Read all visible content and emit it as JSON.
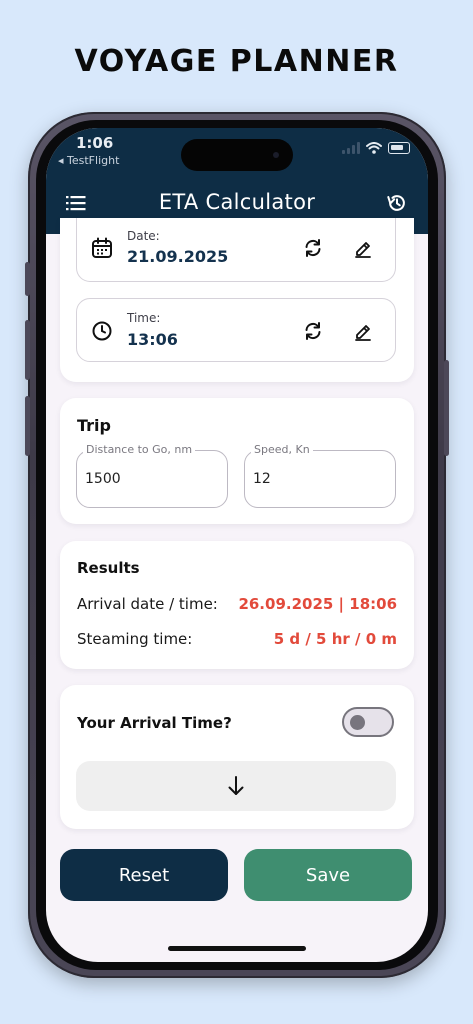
{
  "page": {
    "title": "VOYAGE PLANNER"
  },
  "status_bar": {
    "time": "1:06",
    "back_app": "◂ TestFlight"
  },
  "header": {
    "title": "ETA Calculator"
  },
  "datetime": {
    "date_label": "Date:",
    "date_value": "21.09.2025",
    "time_label": "Time:",
    "time_value": "13:06"
  },
  "trip": {
    "title": "Trip",
    "distance_label": "Distance to Go, nm",
    "distance_value": "1500",
    "speed_label": "Speed, Kn",
    "speed_value": "12"
  },
  "results": {
    "title": "Results",
    "arrival_label": "Arrival date / time:",
    "arrival_value": "26.09.2025 | 18:06",
    "steaming_label": "Steaming time:",
    "steaming_value": "5 d / 5 hr / 0 m"
  },
  "arrival": {
    "label": "Your Arrival Time?",
    "toggle_on": false
  },
  "actions": {
    "reset_label": "Reset",
    "save_label": "Save"
  },
  "colors": {
    "header_bg": "#0e2d45",
    "accent_red": "#e24a3b",
    "save_green": "#3f8e70",
    "page_bg": "#d8e8fb"
  },
  "icons": {
    "menu": "menu-icon",
    "history": "history-icon",
    "calendar": "calendar-icon",
    "clock": "clock-icon",
    "refresh": "refresh-icon",
    "edit": "edit-icon",
    "arrow_down": "arrow-down-icon"
  }
}
